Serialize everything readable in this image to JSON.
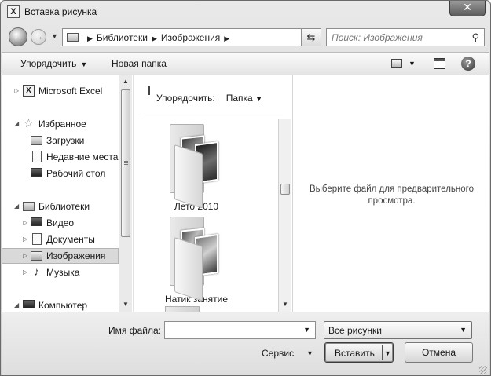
{
  "window": {
    "title": "Вставка рисунка",
    "app_icon": "excel-icon",
    "close_label": "✕"
  },
  "address": {
    "crumbs": [
      "Библиотеки",
      "Изображения"
    ],
    "search_placeholder": "Поиск: Изображения"
  },
  "toolbar": {
    "organize_label": "Упорядочить",
    "new_folder_label": "Новая папка",
    "help_label": "?"
  },
  "nav": {
    "items": [
      {
        "label": "Microsoft Excel",
        "icon": "excel-icon"
      },
      {
        "label": "Избранное",
        "icon": "star-icon"
      },
      {
        "label": "Загрузки",
        "icon": "downloads-icon"
      },
      {
        "label": "Недавние места",
        "icon": "recent-places-icon"
      },
      {
        "label": "Рабочий стол",
        "icon": "desktop-icon"
      },
      {
        "label": "Библиотеки",
        "icon": "library-icon"
      },
      {
        "label": "Видео",
        "icon": "video-icon"
      },
      {
        "label": "Документы",
        "icon": "documents-icon"
      },
      {
        "label": "Изображения",
        "icon": "pictures-icon"
      },
      {
        "label": "Музыка",
        "icon": "music-icon"
      },
      {
        "label": "Компьютер",
        "icon": "computer-icon"
      }
    ],
    "selected": "Изображения"
  },
  "files": {
    "header_label": "Упорядочить:",
    "sort_value": "Папка",
    "folders": [
      {
        "name": "Лето 2010"
      },
      {
        "name": "Натик занятие"
      }
    ]
  },
  "preview": {
    "message": "Выберите файл для предварительного просмотра."
  },
  "bottom": {
    "filename_label": "Имя файла:",
    "filename_value": "",
    "filter_value": "Все рисунки",
    "service_label": "Сервис",
    "insert_label": "Вставить",
    "cancel_label": "Отмена"
  }
}
